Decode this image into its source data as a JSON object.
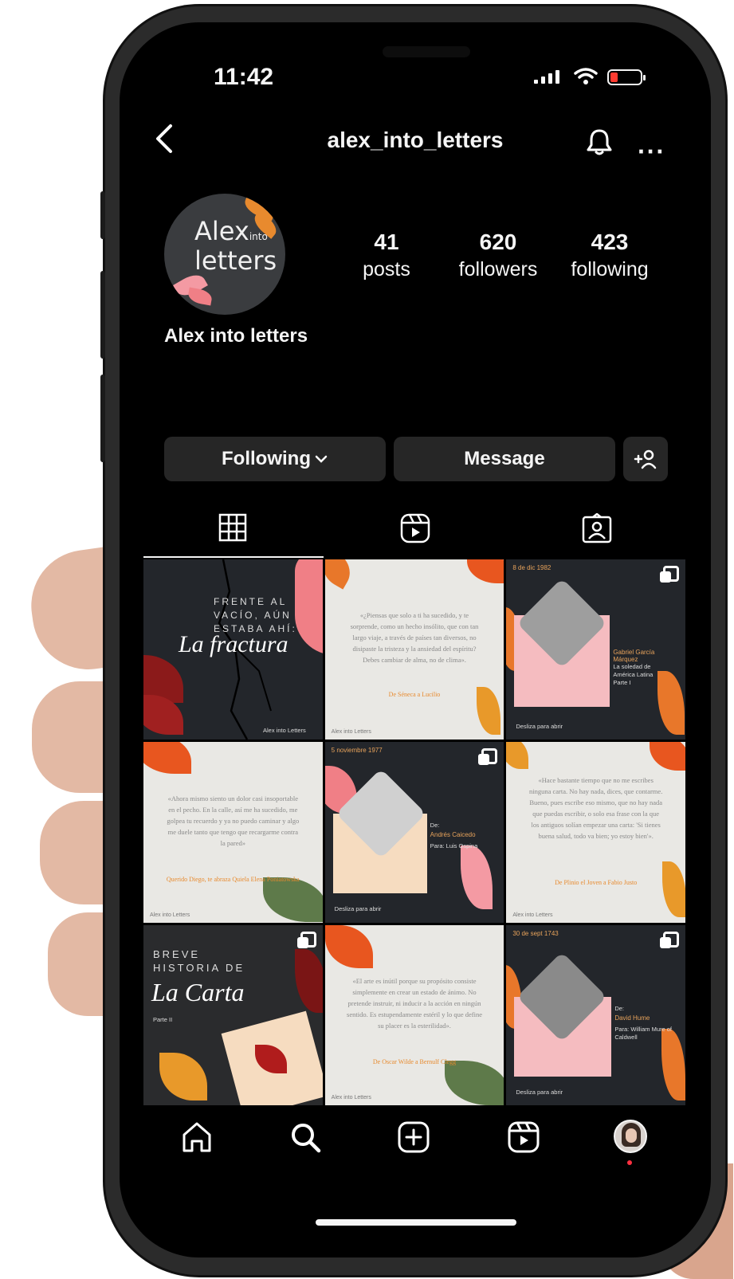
{
  "status_bar": {
    "time": "11:42"
  },
  "header": {
    "username": "alex_into_letters"
  },
  "profile": {
    "avatar_text_line1": "Alex",
    "avatar_text_into": "into",
    "avatar_text_line2": "letters",
    "display_name": "Alex into letters",
    "stats": [
      {
        "value": "41",
        "label": "posts"
      },
      {
        "value": "620",
        "label": "followers"
      },
      {
        "value": "423",
        "label": "following"
      }
    ]
  },
  "actions": {
    "following_label": "Following",
    "message_label": "Message"
  },
  "tabs": [
    {
      "icon": "grid-icon",
      "active": true
    },
    {
      "icon": "reels-icon",
      "active": false
    },
    {
      "icon": "tagged-icon",
      "active": false
    }
  ],
  "posts": [
    {
      "lines": [
        "FRENTE AL",
        "VACÍO, AÚN",
        "ESTABA AHÍ:"
      ],
      "title": "La fractura",
      "sig": "Alex into Letters"
    },
    {
      "quote": "«¿Piensas que solo a ti ha sucedido, y te sorprende, como un hecho insólito, que con tan largo viaje, a través de países tan diversos, no disipaste la tristeza y la ansiedad del espíritu? Debes cambiar de alma, no de clima».",
      "author": "De Séneca a Lucilio",
      "sig": "Alex into Letters"
    },
    {
      "date": "8 de dic 1982",
      "to": "Gabriel García Márquez",
      "subject": "La soledad de América Latina Parte I",
      "cta": "Desliza para abrir"
    },
    {
      "quote": "«Ahora mismo siento un dolor casi insoportable en el pecho. En la calle, así me ha sucedido, me golpea tu recuerdo y ya no puedo caminar y algo me duele tanto que tengo que recargarme contra la pared»",
      "author": "Querido Diego, te abraza Quiela Elena Poniatowska",
      "sig": "Alex into Letters"
    },
    {
      "date": "5 noviembre 1977",
      "from_label": "De:",
      "from": "Andrés Caicedo",
      "to": "Para: Luis Ospina",
      "cta": "Desliza para abrir"
    },
    {
      "quote": "«Hace bastante tiempo que no me escribes ninguna carta. No hay nada, dices, que contarme. Bueno, pues escribe eso mismo, que no hay nada que puedas escribir, o solo esa frase con la que los antiguos solían empezar una carta: 'Si tienes buena salud, todo va bien; yo estoy bien'».",
      "author": "De Plinio el Joven a Fabio Justo",
      "sig": "Alex into Letters"
    },
    {
      "lines": [
        "BREVE",
        "HISTORIA DE"
      ],
      "title": "La Carta",
      "part": "Parte II"
    },
    {
      "quote": "«El arte es inútil porque su propósito consiste simplemente en crear un estado de ánimo. No pretende instruir, ni inducir a la acción en ningún sentido. Es estupendamente estéril y lo que define su placer es la esterilidad».",
      "author": "De Oscar Wilde a Bernulf Clegg",
      "sig": "Alex into Letters"
    },
    {
      "date": "30 de sept 1743",
      "from_label": "De:",
      "from": "David Hume",
      "to": "Para: William Mure of Caldwell",
      "cta": "Desliza para abrir"
    }
  ],
  "colors": {
    "background": "#000000",
    "button": "#262626",
    "accent_orange": "#e8772a",
    "accent_pink": "#f4a0a8",
    "notification_dot": "#ff3040"
  }
}
